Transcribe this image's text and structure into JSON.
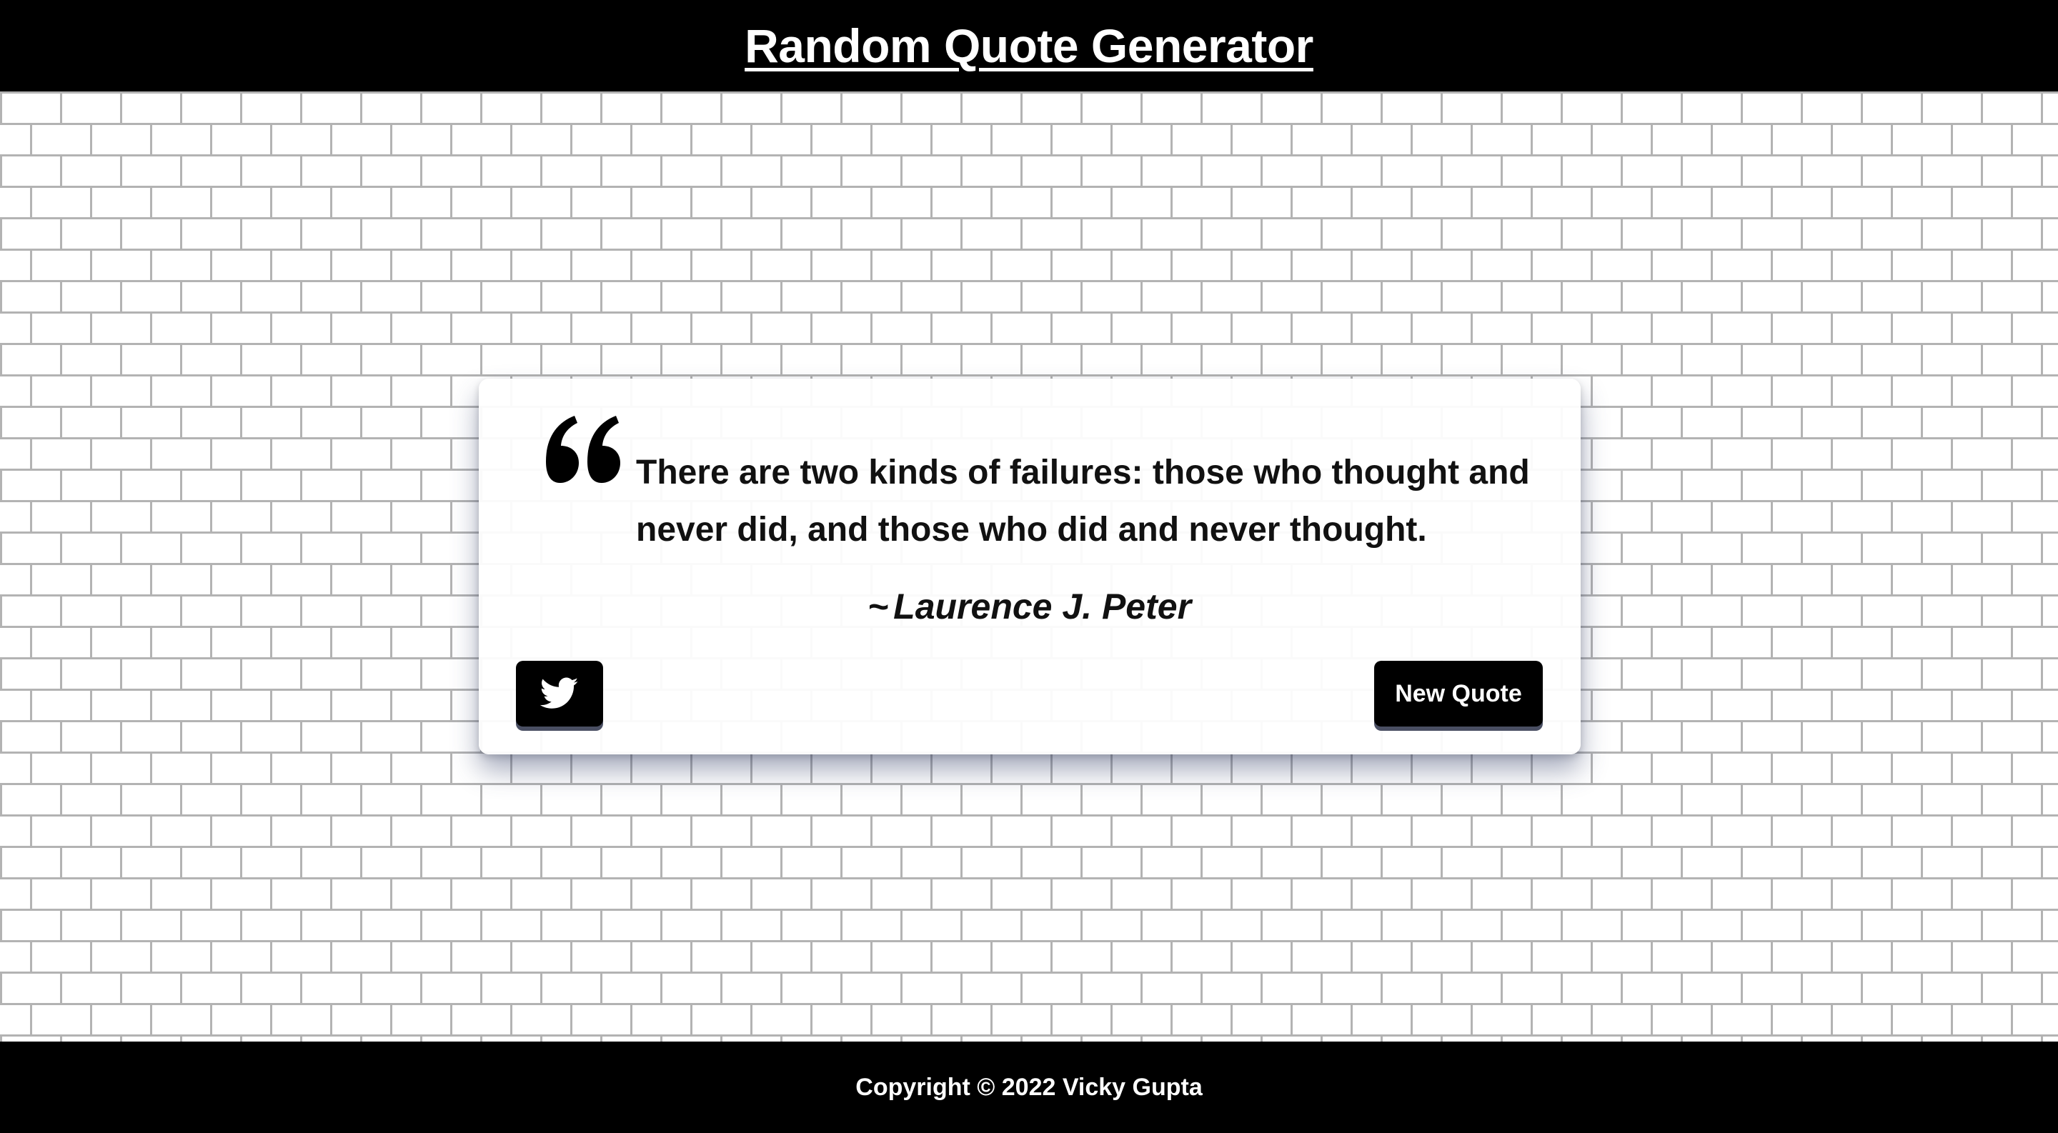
{
  "header": {
    "title": "Random Quote Generator"
  },
  "quote": {
    "text": "There are two kinds of failures: those who thought and never did, and those who did and never thought.",
    "author_prefix": "~",
    "author": "Laurence J. Peter",
    "quote_icon": "quote-left-icon"
  },
  "actions": {
    "tweet_icon": "twitter-icon",
    "new_quote_label": "New Quote"
  },
  "footer": {
    "copyright": "Copyright © 2022 Vicky Gupta"
  },
  "colors": {
    "bar_background": "#000000",
    "bar_text": "#ffffff",
    "wall_mortar": "#b3b3b3",
    "wall_brick": "#ffffff",
    "button_background": "#000000",
    "button_shadow": "#4a4f63"
  }
}
